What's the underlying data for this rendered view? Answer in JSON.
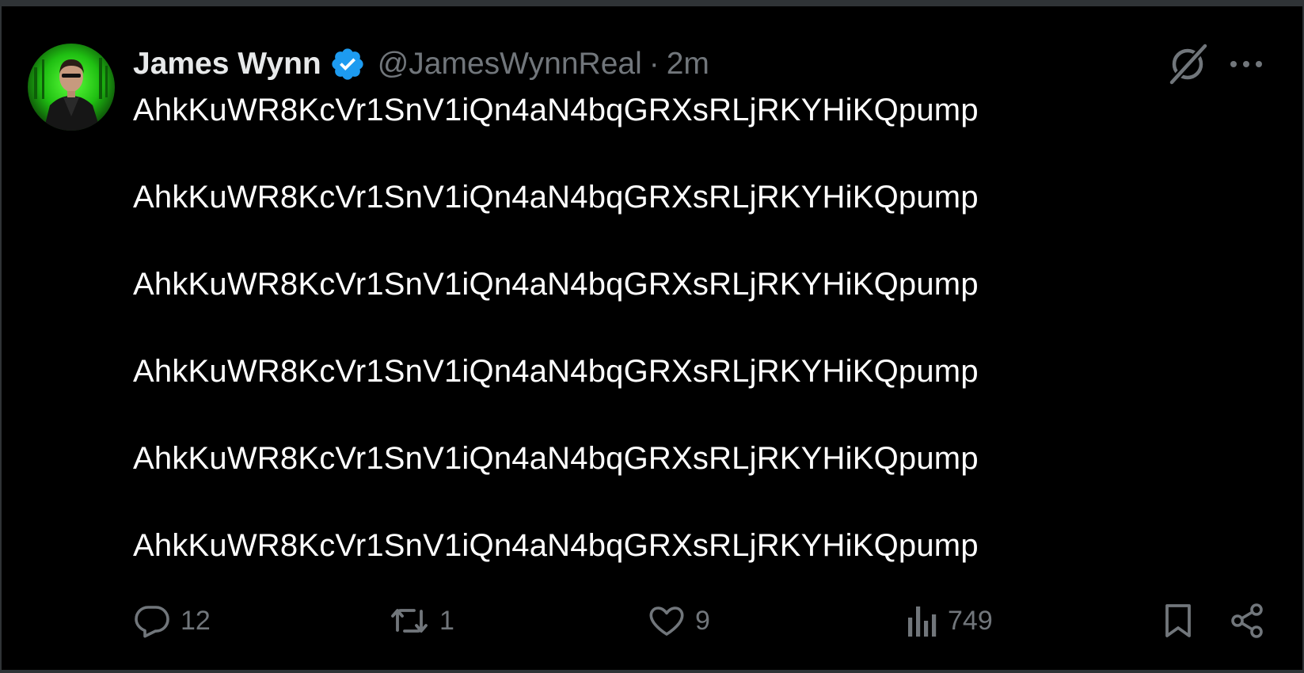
{
  "author": {
    "name": "James Wynn",
    "handle": "@JamesWynnReal",
    "separator": "·",
    "time": "2m",
    "verified": true
  },
  "tweet": {
    "lines": [
      "AhkKuWR8KcVr1SnV1iQn4aN4bqGRXsRLjRKYHiKQpump",
      "AhkKuWR8KcVr1SnV1iQn4aN4bqGRXsRLjRKYHiKQpump",
      "AhkKuWR8KcVr1SnV1iQn4aN4bqGRXsRLjRKYHiKQpump",
      "AhkKuWR8KcVr1SnV1iQn4aN4bqGRXsRLjRKYHiKQpump",
      "AhkKuWR8KcVr1SnV1iQn4aN4bqGRXsRLjRKYHiKQpump",
      "AhkKuWR8KcVr1SnV1iQn4aN4bqGRXsRLjRKYHiKQpump"
    ]
  },
  "actions": {
    "replies": "12",
    "reposts": "1",
    "likes": "9",
    "views": "749"
  },
  "icons": {
    "verified": "verified-badge-icon",
    "grok": "grok-icon",
    "more": "more-options-icon",
    "reply": "reply-icon",
    "repost": "repost-icon",
    "like": "like-icon",
    "views": "views-icon",
    "bookmark": "bookmark-icon",
    "share": "share-icon"
  },
  "colors": {
    "background": "#000000",
    "text": "#e7e9ea",
    "secondary": "#71767b",
    "verified": "#1d9bf0",
    "avatar_accent": "#1fd11f"
  }
}
